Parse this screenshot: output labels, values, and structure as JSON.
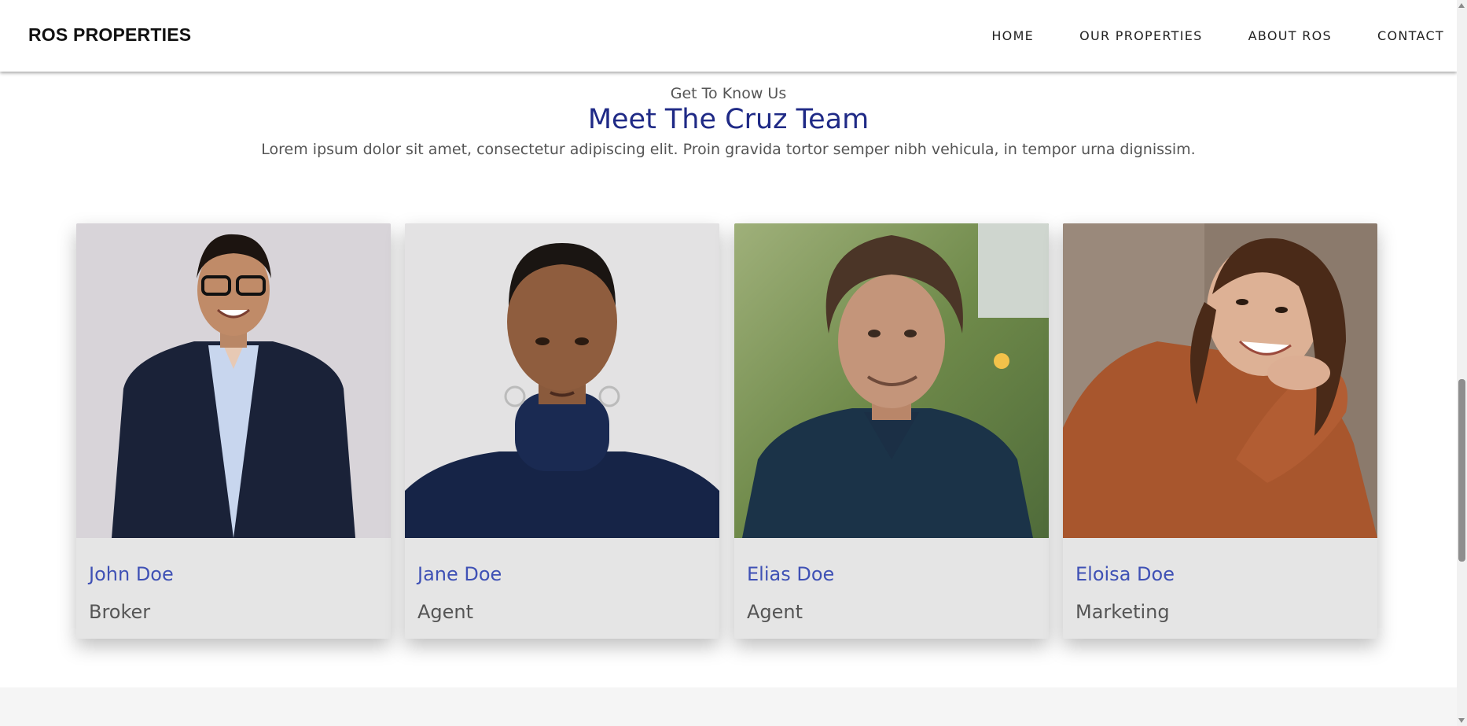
{
  "header": {
    "brand": "ROS PROPERTIES",
    "nav": [
      "HOME",
      "OUR PROPERTIES",
      "ABOUT ROS",
      "CONTACT"
    ]
  },
  "section": {
    "kicker": "Get To Know Us",
    "title": "Meet The Cruz Team",
    "lede": "Lorem ipsum dolor sit amet, consectetur adipiscing elit. Proin gravida tortor semper nibh vehicula, in tempor urna dignissim."
  },
  "team": [
    {
      "name": "John Doe",
      "role": "Broker"
    },
    {
      "name": "Jane Doe",
      "role": "Agent"
    },
    {
      "name": "Elias Doe",
      "role": "Agent"
    },
    {
      "name": "Eloisa Doe",
      "role": "Marketing"
    }
  ],
  "colors": {
    "accent_title": "#1f2a86",
    "accent_name": "#3f51b5",
    "card_bg": "#e5e5e5"
  }
}
